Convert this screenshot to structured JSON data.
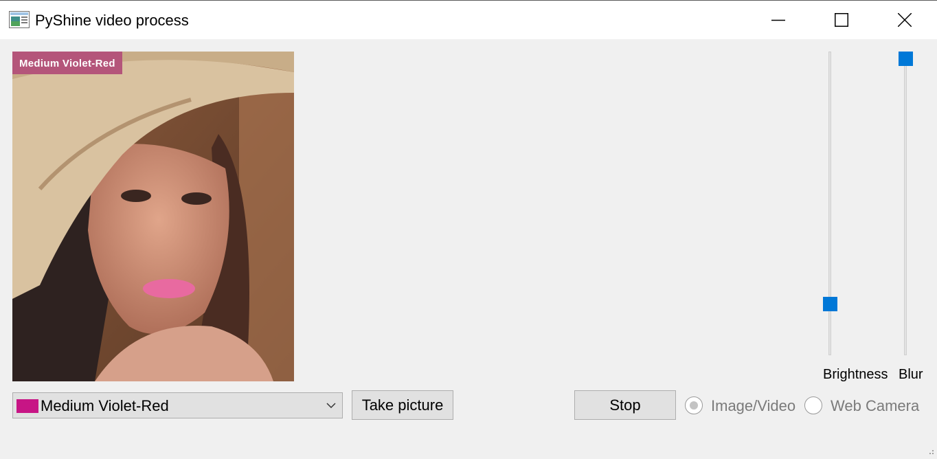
{
  "window": {
    "title": "PyShine video process",
    "icon": "app-window-icon",
    "controls": [
      "minimize-icon",
      "maximize-icon",
      "close-icon"
    ]
  },
  "video": {
    "overlay_label": "Medium Violet-Red",
    "overlay_color": "#b4557a"
  },
  "sliders": {
    "brightness": {
      "label": "Brightness",
      "level": 0.15,
      "handle_color": "#0078d7"
    },
    "blur": {
      "label": "Blur",
      "level": 1.0,
      "handle_color": "#0078d7"
    }
  },
  "controls": {
    "color_select": {
      "value": "Medium Violet-Red",
      "swatch": "#c71585"
    },
    "take_picture_label": "Take picture",
    "stop_label": "Stop",
    "radio_image_video": {
      "label": "Image/Video",
      "selected": true
    },
    "radio_web_camera": {
      "label": "Web Camera",
      "selected": false
    }
  }
}
